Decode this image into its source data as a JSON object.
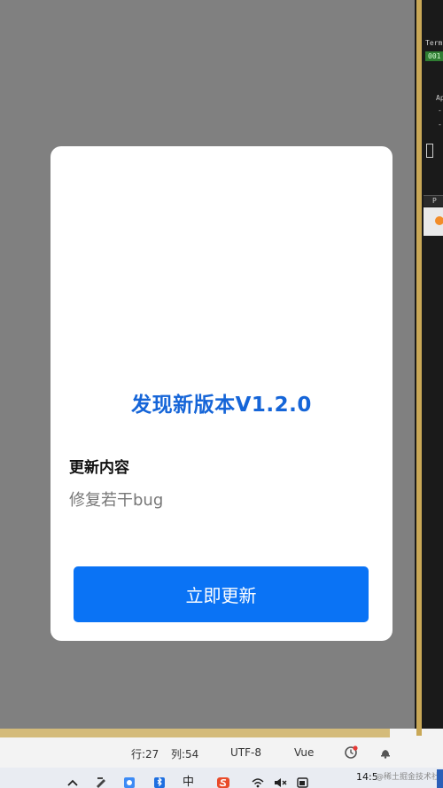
{
  "dialog": {
    "title": "发现新版本V1.2.0",
    "section_label": "更新内容",
    "content": "修复若干bug",
    "button_label": "立即更新"
  },
  "terminal": {
    "header": "Term",
    "badge": "001",
    "line_1": "Ap",
    "line_2": "-",
    "line_3": "-",
    "panel_label": "P"
  },
  "status_bar": {
    "line": "行:27",
    "column": "列:54",
    "encoding": "UTF-8",
    "language": "Vue"
  },
  "taskbar": {
    "ime_label": "中",
    "clock": "14:5",
    "watermark": "@稀土掘金技术社区"
  },
  "colors": {
    "title_blue": "#1565d8",
    "button_blue": "#0a73f5",
    "overlay_grey": "#808080",
    "gold": "#c9a857"
  }
}
